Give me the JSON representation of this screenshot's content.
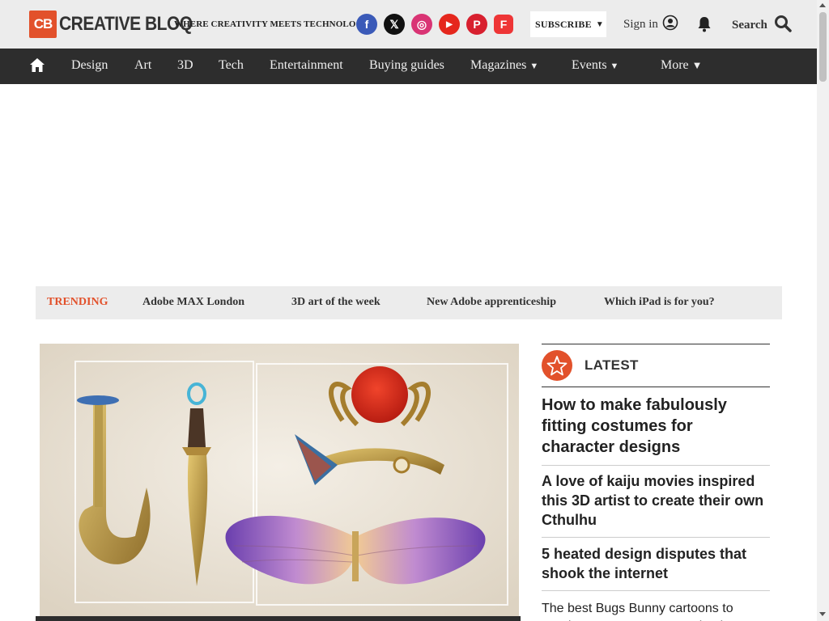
{
  "header": {
    "logo_badge": "CB",
    "logo_word": "CREATIVE BLOQ",
    "tagline": "WHERE CREATIVITY MEETS TECHNOLOGY",
    "socials": [
      {
        "name": "facebook-icon",
        "glyph": "f",
        "color": "#3b5ab8"
      },
      {
        "name": "x-twitter-icon",
        "glyph": "𝕏",
        "color": "#111111"
      },
      {
        "name": "instagram-icon",
        "glyph": "◎",
        "color": "#d93474"
      },
      {
        "name": "youtube-icon",
        "glyph": "▶",
        "color": "#e5271d"
      },
      {
        "name": "pinterest-icon",
        "glyph": "P",
        "color": "#d8202f"
      },
      {
        "name": "flipboard-icon",
        "glyph": "F",
        "color": "#ee3536"
      }
    ],
    "subscribe_label": "SUBSCRIBE",
    "signin_label": "Sign in",
    "search_label": "Search"
  },
  "nav": {
    "items": [
      "Design",
      "Art",
      "3D",
      "Tech",
      "Entertainment",
      "Buying guides",
      "Magazines",
      "Events",
      "More"
    ]
  },
  "trending": {
    "label": "TRENDING",
    "items": [
      "Adobe MAX London",
      "3D art of the week",
      "New Adobe apprenticeship",
      "Which iPad is for you?"
    ]
  },
  "latest": {
    "title": "LATEST",
    "items": [
      "How to make fabulously fitting costumes for character designs",
      "A love of kaiju movies inspired this 3D artist to create their own Cthulhu",
      "5 heated design disputes that shook the internet",
      "The best Bugs Bunny cartoons to watch on Bugs Bunny Day (and yes I"
    ]
  },
  "colors": {
    "accent": "#e2512b",
    "nav_bg": "#2d2d2d",
    "header_bg": "#ececec"
  }
}
